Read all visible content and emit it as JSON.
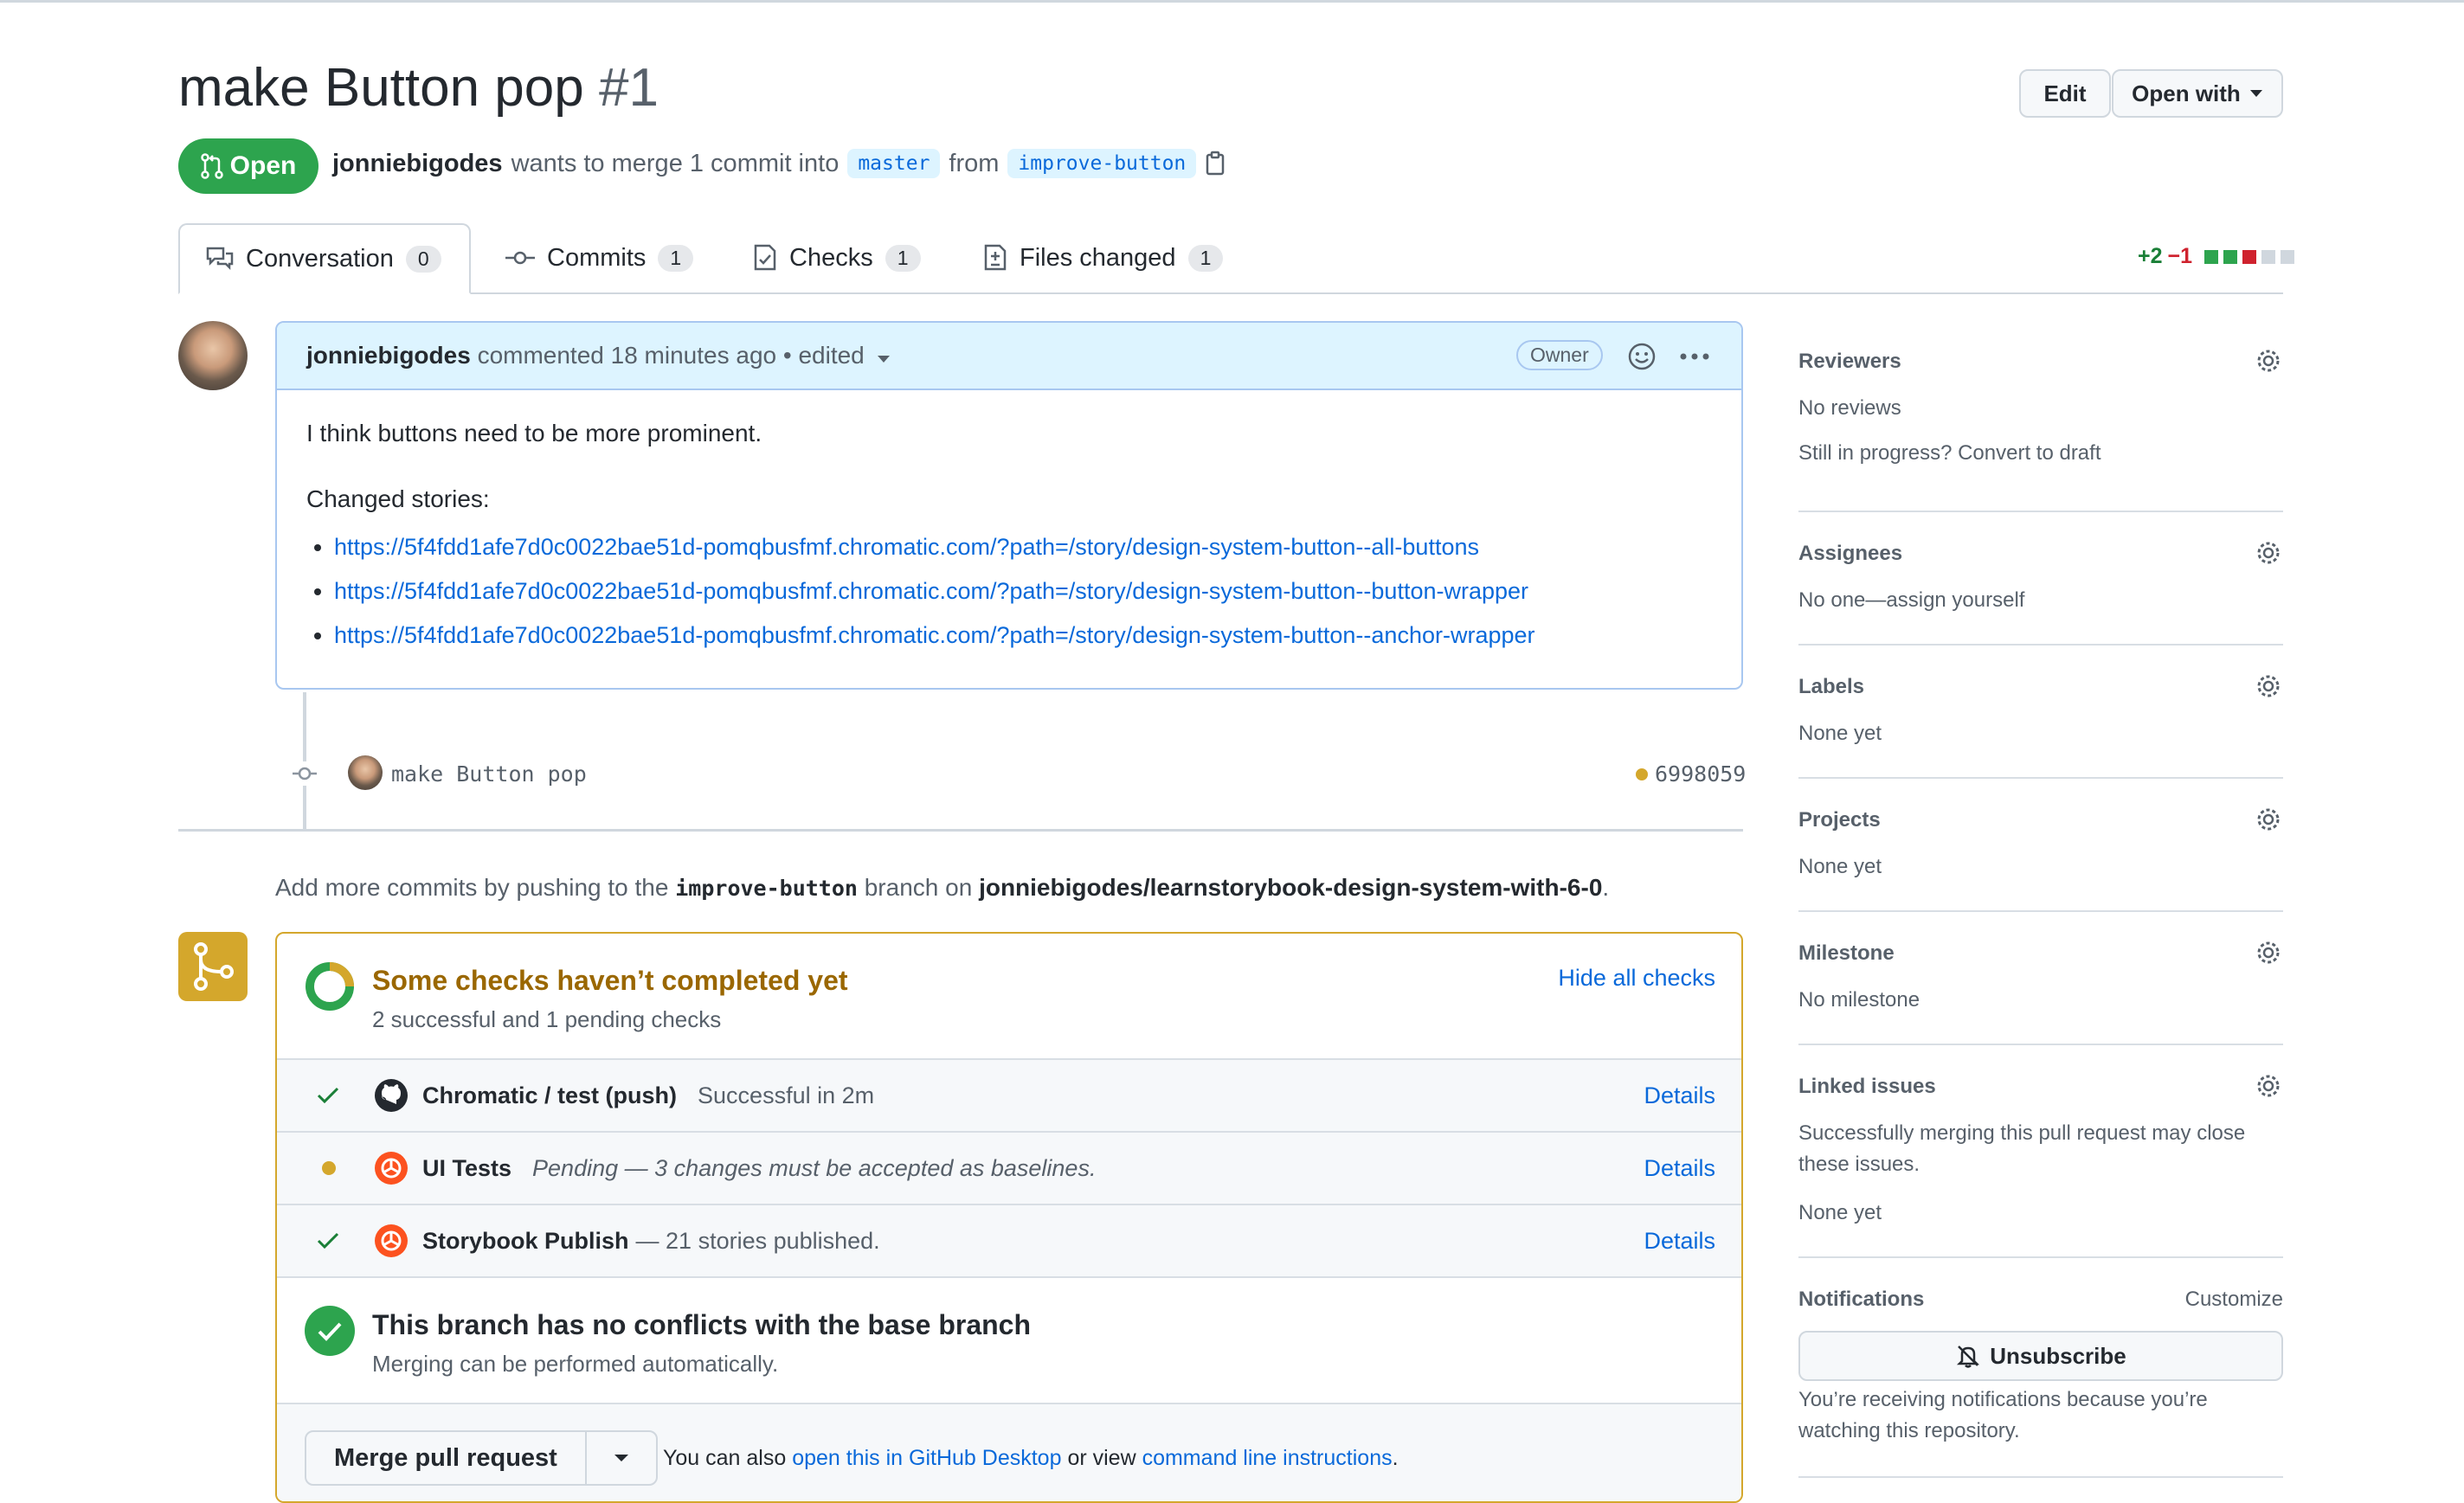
{
  "pr": {
    "title": "make Button pop",
    "number": "#1",
    "state": "Open",
    "author": "jonniebigodes",
    "merge_text": "wants to merge 1 commit into",
    "base_branch": "master",
    "from_text": "from",
    "head_branch": "improve-button"
  },
  "header_buttons": {
    "edit": "Edit",
    "open_with": "Open with"
  },
  "tabs": [
    {
      "label": "Conversation",
      "count": "0"
    },
    {
      "label": "Commits",
      "count": "1"
    },
    {
      "label": "Checks",
      "count": "1"
    },
    {
      "label": "Files changed",
      "count": "1"
    }
  ],
  "diffstat": {
    "added": "+2",
    "removed": "−1"
  },
  "comment": {
    "author": "jonniebigodes",
    "meta": "commented 18 minutes ago • edited",
    "badge": "Owner",
    "body_line1": "I think buttons need to be more prominent.",
    "body_line2": "Changed stories:",
    "links": [
      "https://5f4fdd1afe7d0c0022bae51d-pomqbusfmf.chromatic.com/?path=/story/design-system-button--all-buttons",
      "https://5f4fdd1afe7d0c0022bae51d-pomqbusfmf.chromatic.com/?path=/story/design-system-button--button-wrapper",
      "https://5f4fdd1afe7d0c0022bae51d-pomqbusfmf.chromatic.com/?path=/story/design-system-button--anchor-wrapper"
    ]
  },
  "commit": {
    "message": "make Button pop",
    "sha": "6998059"
  },
  "hint": {
    "prefix": "Add more commits by pushing to the",
    "branch": "improve-button",
    "mid": "branch on",
    "repo": "jonniebigodes/learnstorybook-design-system-with-6-0",
    "suffix": "."
  },
  "checks": {
    "title": "Some checks haven’t completed yet",
    "subtitle": "2 successful and 1 pending checks",
    "hide_link": "Hide all checks",
    "items": [
      {
        "name": "Chromatic / test (push)",
        "desc": "Successful in 2m",
        "details": "Details"
      },
      {
        "name": "UI Tests",
        "desc": "Pending — 3 changes must be accepted as baselines.",
        "details": "Details"
      },
      {
        "name": "Storybook Publish",
        "desc": "— 21 stories published.",
        "details": "Details"
      }
    ],
    "no_conflict_title": "This branch has no conflicts with the base branch",
    "no_conflict_sub": "Merging can be performed automatically."
  },
  "merge": {
    "button": "Merge pull request",
    "also_text": "You can also",
    "desktop_link": "open this in GitHub Desktop",
    "or_text": "or view",
    "cli_link": "command line instructions",
    "end": "."
  },
  "sidebar": {
    "reviewers": {
      "title": "Reviewers",
      "line1": "No reviews",
      "line2": "Still in progress? Convert to draft"
    },
    "assignees": {
      "title": "Assignees",
      "line1": "No one—assign yourself"
    },
    "labels": {
      "title": "Labels",
      "line1": "None yet"
    },
    "projects": {
      "title": "Projects",
      "line1": "None yet"
    },
    "milestone": {
      "title": "Milestone",
      "line1": "No milestone"
    },
    "linked": {
      "title": "Linked issues",
      "line1": "Successfully merging this pull request may close",
      "line2": "these issues.",
      "line3": "None yet"
    },
    "notifications": {
      "title": "Notifications",
      "customize": "Customize",
      "unsubscribe": "Unsubscribe",
      "line1": "You’re receiving notifications because you’re",
      "line2": "watching this repository."
    }
  },
  "colors": {
    "success": "#2da44e",
    "pending": "#d4a72c",
    "link": "#0969da"
  }
}
